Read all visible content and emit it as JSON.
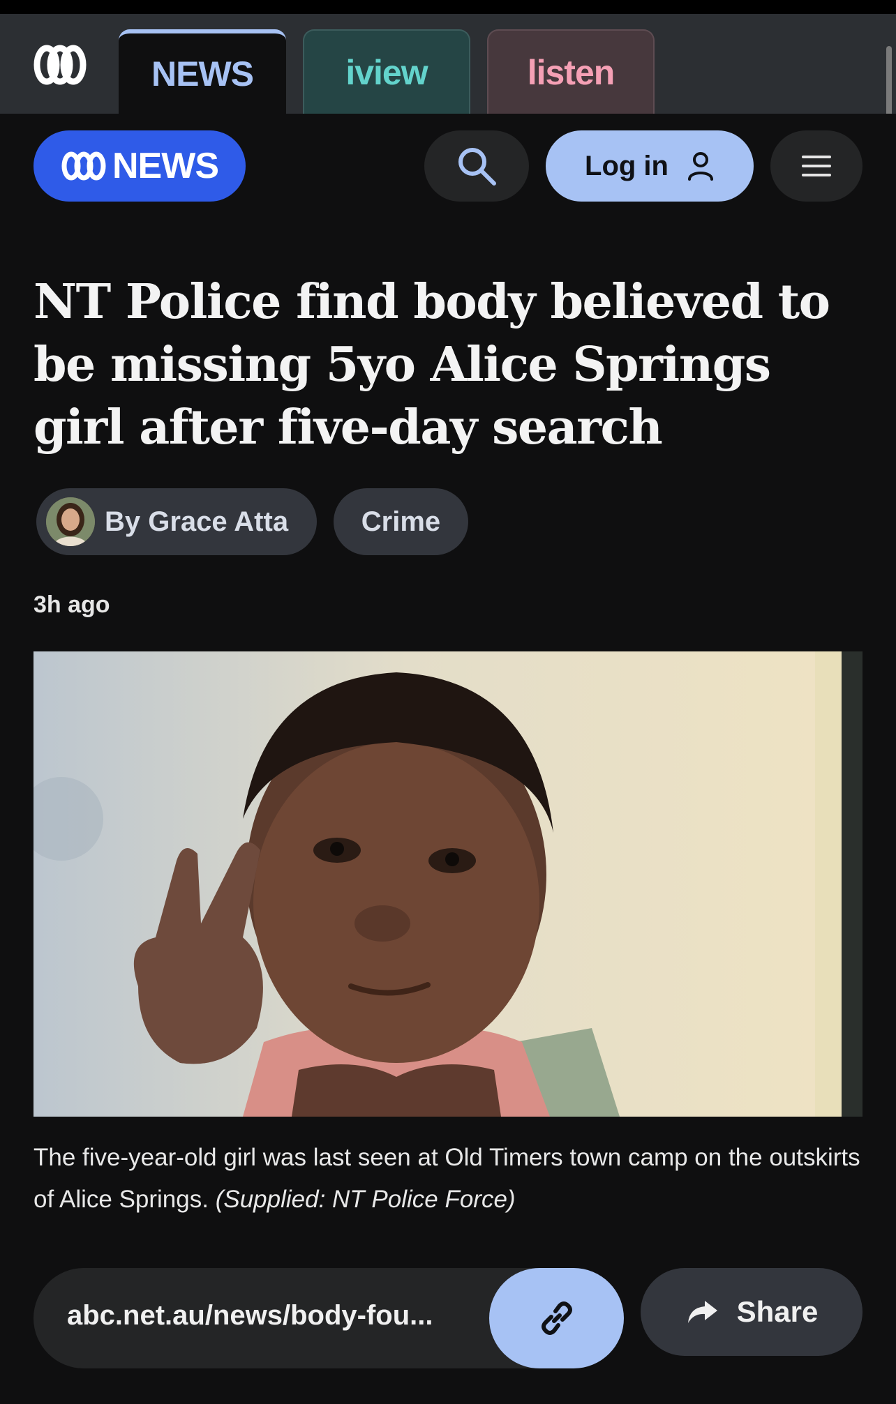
{
  "tabs": {
    "news_label": "NEWS",
    "iview_label": "iview",
    "listen_label": "listen"
  },
  "header": {
    "brand_label": "NEWS",
    "login_label": "Log in"
  },
  "article": {
    "headline": "NT Police find body believed to be missing 5yo Alice Springs girl after five-day search",
    "byline": "By Grace Atta",
    "tag": "Crime",
    "timestamp": "3h ago",
    "caption": "The five-year-old girl was last seen at Old Timers town camp on the outskirts of Alice Springs.",
    "credit": "(Supplied: NT Police Force)"
  },
  "share": {
    "url": "abc.net.au/news/body-fou...",
    "share_label": "Share"
  },
  "icons": {
    "logo": "abc-logo-icon",
    "search": "search-icon",
    "user": "user-icon",
    "menu": "hamburger-menu-icon",
    "link": "link-icon",
    "share": "share-arrow-icon"
  },
  "colors": {
    "background": "#0f0f10",
    "news_accent": "#a7c2f4",
    "brand_blue": "#2f5be8",
    "iview_teal": "#63d3cc",
    "listen_pink": "#f5a0b5"
  }
}
